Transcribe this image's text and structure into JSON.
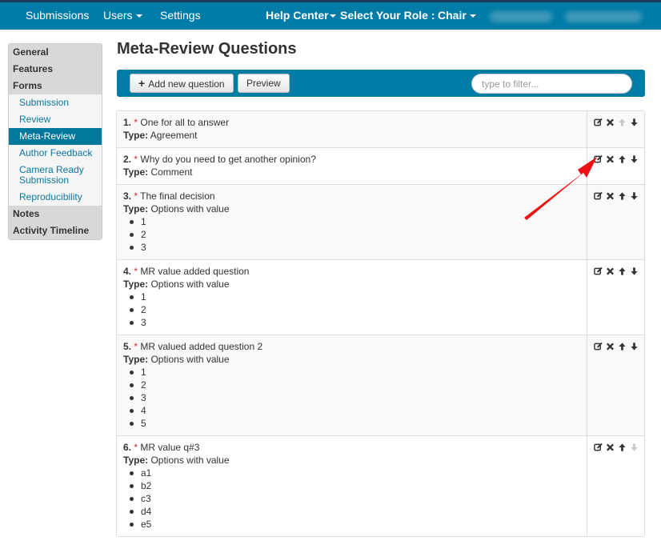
{
  "navbar": {
    "items": [
      {
        "label": "Submissions",
        "dropdown": false
      },
      {
        "label": "Users",
        "dropdown": true
      },
      {
        "label": "Settings",
        "dropdown": false
      }
    ],
    "help_center": "Help Center",
    "role_label": "Select Your Role :",
    "role_value": "Chair"
  },
  "sidebar": {
    "sections": [
      {
        "label": "General"
      },
      {
        "label": "Features"
      },
      {
        "label": "Forms"
      }
    ],
    "form_links": [
      {
        "label": "Submission",
        "active": false
      },
      {
        "label": "Review",
        "active": false
      },
      {
        "label": "Meta-Review",
        "active": true
      },
      {
        "label": "Author Feedback",
        "active": false
      },
      {
        "label": "Camera Ready Submission",
        "active": false
      },
      {
        "label": "Reproducibility",
        "active": false
      }
    ],
    "bottom_sections": [
      {
        "label": "Notes"
      },
      {
        "label": "Activity Timeline"
      }
    ]
  },
  "page": {
    "title": "Meta-Review Questions"
  },
  "toolbar": {
    "add_label": "Add new question",
    "add_icon": "plus-icon",
    "preview_label": "Preview",
    "filter_placeholder": "type to filter...",
    "filter_value": ""
  },
  "questions": [
    {
      "num": "1.",
      "required_mark": "*",
      "text": "One for all to answer",
      "type_label": "Type:",
      "type": "Agreement",
      "options": [],
      "can_move_up": false,
      "can_move_down": true
    },
    {
      "num": "2.",
      "required_mark": "*",
      "text": "Why do you need to get another opinion?",
      "type_label": "Type:",
      "type": "Comment",
      "options": [],
      "can_move_up": true,
      "can_move_down": true
    },
    {
      "num": "3.",
      "required_mark": "*",
      "text": "The final decision",
      "type_label": "Type:",
      "type": "Options with value",
      "options": [
        "1",
        "2",
        "3"
      ],
      "can_move_up": true,
      "can_move_down": true
    },
    {
      "num": "4.",
      "required_mark": "*",
      "text": "MR value added question",
      "type_label": "Type:",
      "type": "Options with value",
      "options": [
        "1",
        "2",
        "3"
      ],
      "can_move_up": true,
      "can_move_down": true
    },
    {
      "num": "5.",
      "required_mark": "*",
      "text": "MR valued added question 2",
      "type_label": "Type:",
      "type": "Options with value",
      "options": [
        "1",
        "2",
        "3",
        "4",
        "5"
      ],
      "can_move_up": true,
      "can_move_down": true
    },
    {
      "num": "6.",
      "required_mark": "*",
      "text": "MR value q#3",
      "type_label": "Type:",
      "type": "Options with value",
      "options": [
        "a1",
        "b2",
        "c3",
        "d4",
        "e5"
      ],
      "can_move_up": true,
      "can_move_down": false
    }
  ],
  "row_actions": [
    "edit-icon",
    "delete-icon",
    "move-up-icon",
    "move-down-icon"
  ],
  "colors": {
    "brand": "#007ca6",
    "active_link_bg": "#00789e",
    "link": "#0b77a0",
    "required": "#c9302c",
    "annotation_arrow": "#ee1111",
    "disabled_icon": "#c8c8c8"
  }
}
